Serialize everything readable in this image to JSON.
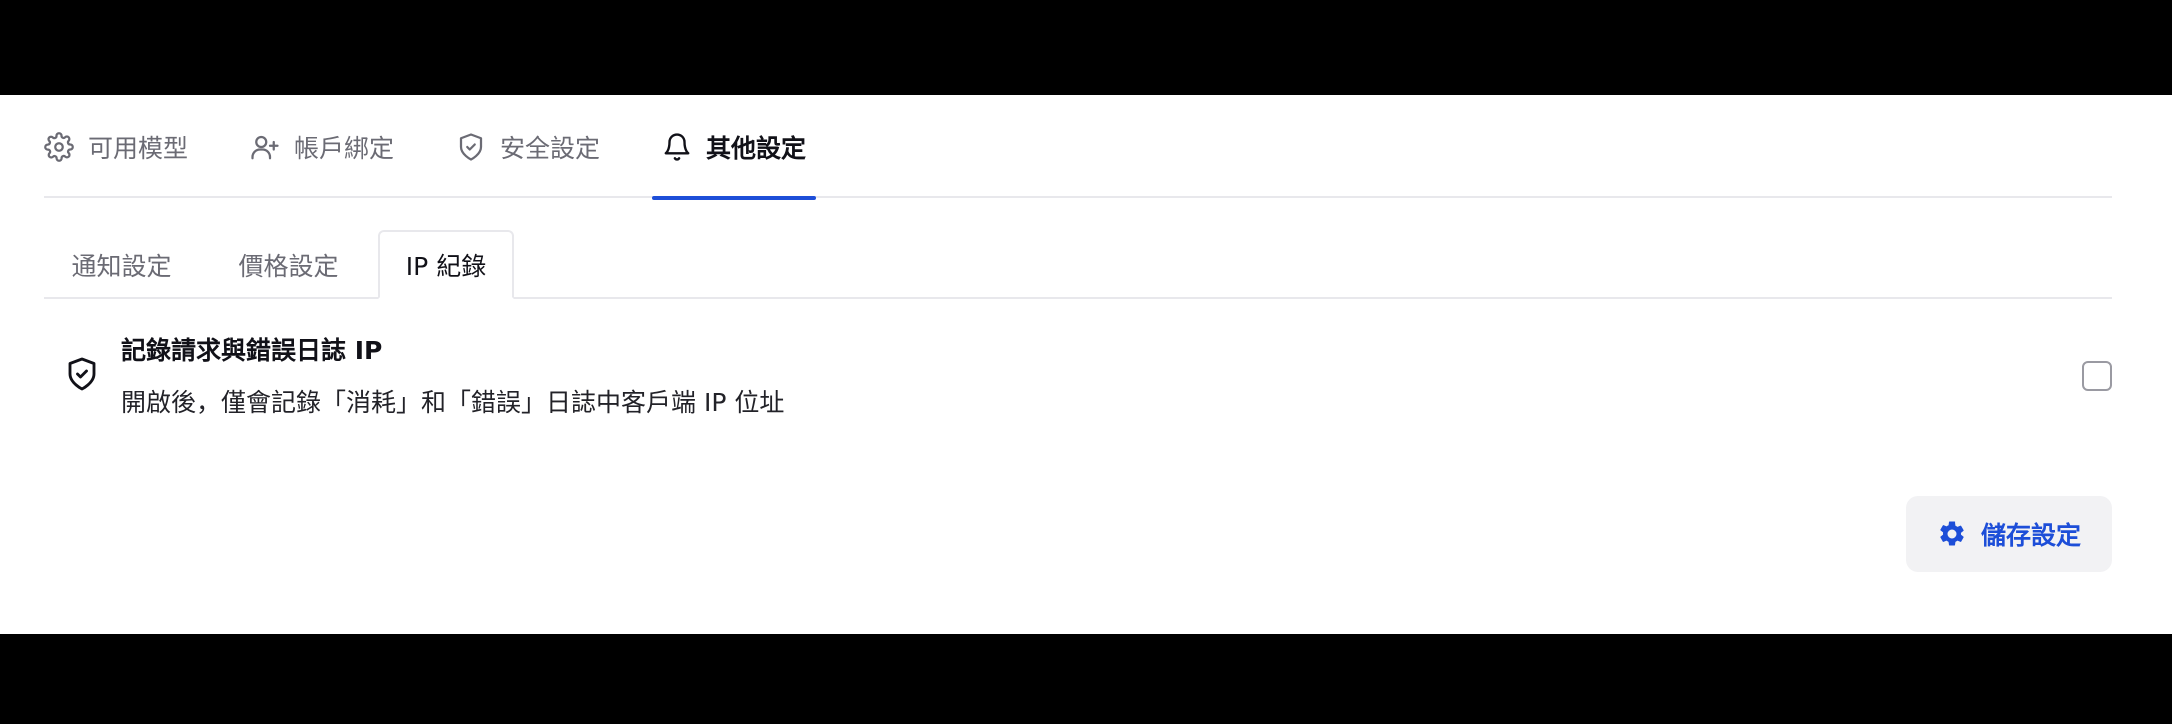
{
  "top_tabs": [
    {
      "label": "可用模型",
      "icon": "gear-icon",
      "active": false
    },
    {
      "label": "帳戶綁定",
      "icon": "user-plus-icon",
      "active": false
    },
    {
      "label": "安全設定",
      "icon": "shield-check-icon",
      "active": false
    },
    {
      "label": "其他設定",
      "icon": "bell-icon",
      "active": true
    }
  ],
  "sub_tabs": [
    {
      "label": "通知設定",
      "active": false
    },
    {
      "label": "價格設定",
      "active": false
    },
    {
      "label": "IP 紀錄",
      "active": true
    }
  ],
  "setting": {
    "icon": "shield-check-icon",
    "title": "記錄請求與錯誤日誌 IP",
    "description": "開啟後，僅會記錄「消耗」和「錯誤」日誌中客戶端 IP 位址",
    "checked": false
  },
  "save_button": {
    "label": "儲存設定",
    "icon": "gear-icon"
  },
  "colors": {
    "accent": "#1d4ed8",
    "text_muted": "#6b6b74",
    "text_primary": "#111118",
    "border": "#e8e8ec",
    "button_bg": "#f2f2f4"
  }
}
